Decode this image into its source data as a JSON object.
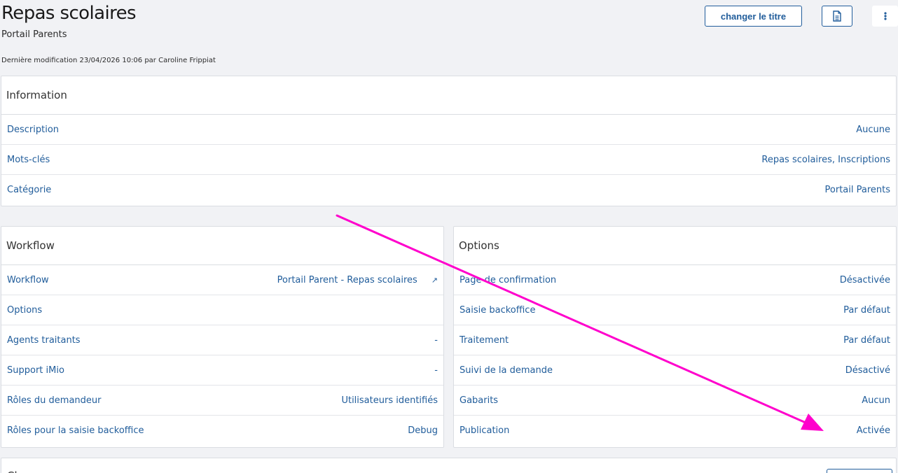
{
  "header": {
    "title": "Repas scolaires",
    "subtitle": "Portail Parents",
    "last_modified": "Dernière modification  23/04/2026 10:06 par Caroline Frippiat",
    "change_title_label": "changer le titre",
    "doc_icon": "document-icon",
    "more_icon": "more-vertical-icon"
  },
  "information": {
    "title": "Information",
    "rows": [
      {
        "label": "Description",
        "value": "Aucune"
      },
      {
        "label": "Mots-clés",
        "value": "Repas scolaires, Inscriptions"
      },
      {
        "label": "Catégorie",
        "value": "Portail Parents"
      }
    ]
  },
  "workflow": {
    "title": "Workflow",
    "rows": [
      {
        "label": "Workflow",
        "value": "Portail Parent - Repas scolaires",
        "icon": "↗"
      },
      {
        "label": "Options",
        "value": ""
      },
      {
        "label": "Agents traitants",
        "value": "-"
      },
      {
        "label": "Support iMio",
        "value": "-"
      },
      {
        "label": "Rôles du demandeur",
        "value": "Utilisateurs identifiés"
      },
      {
        "label": "Rôles pour la saisie backoffice",
        "value": "Debug"
      }
    ]
  },
  "options": {
    "title": "Options",
    "rows": [
      {
        "label": "Page de confirmation",
        "value": "Désactivée"
      },
      {
        "label": "Saisie backoffice",
        "value": "Par défaut"
      },
      {
        "label": "Traitement",
        "value": "Par défaut"
      },
      {
        "label": "Suivi de la demande",
        "value": "Désactivé"
      },
      {
        "label": "Gabarits",
        "value": "Aucun"
      },
      {
        "label": "Publication",
        "value": "Activée"
      }
    ]
  },
  "bottom": {
    "partial_title": "Ch"
  },
  "colors": {
    "accent": "#215d9b",
    "annotation_arrow": "#ff00cc"
  }
}
